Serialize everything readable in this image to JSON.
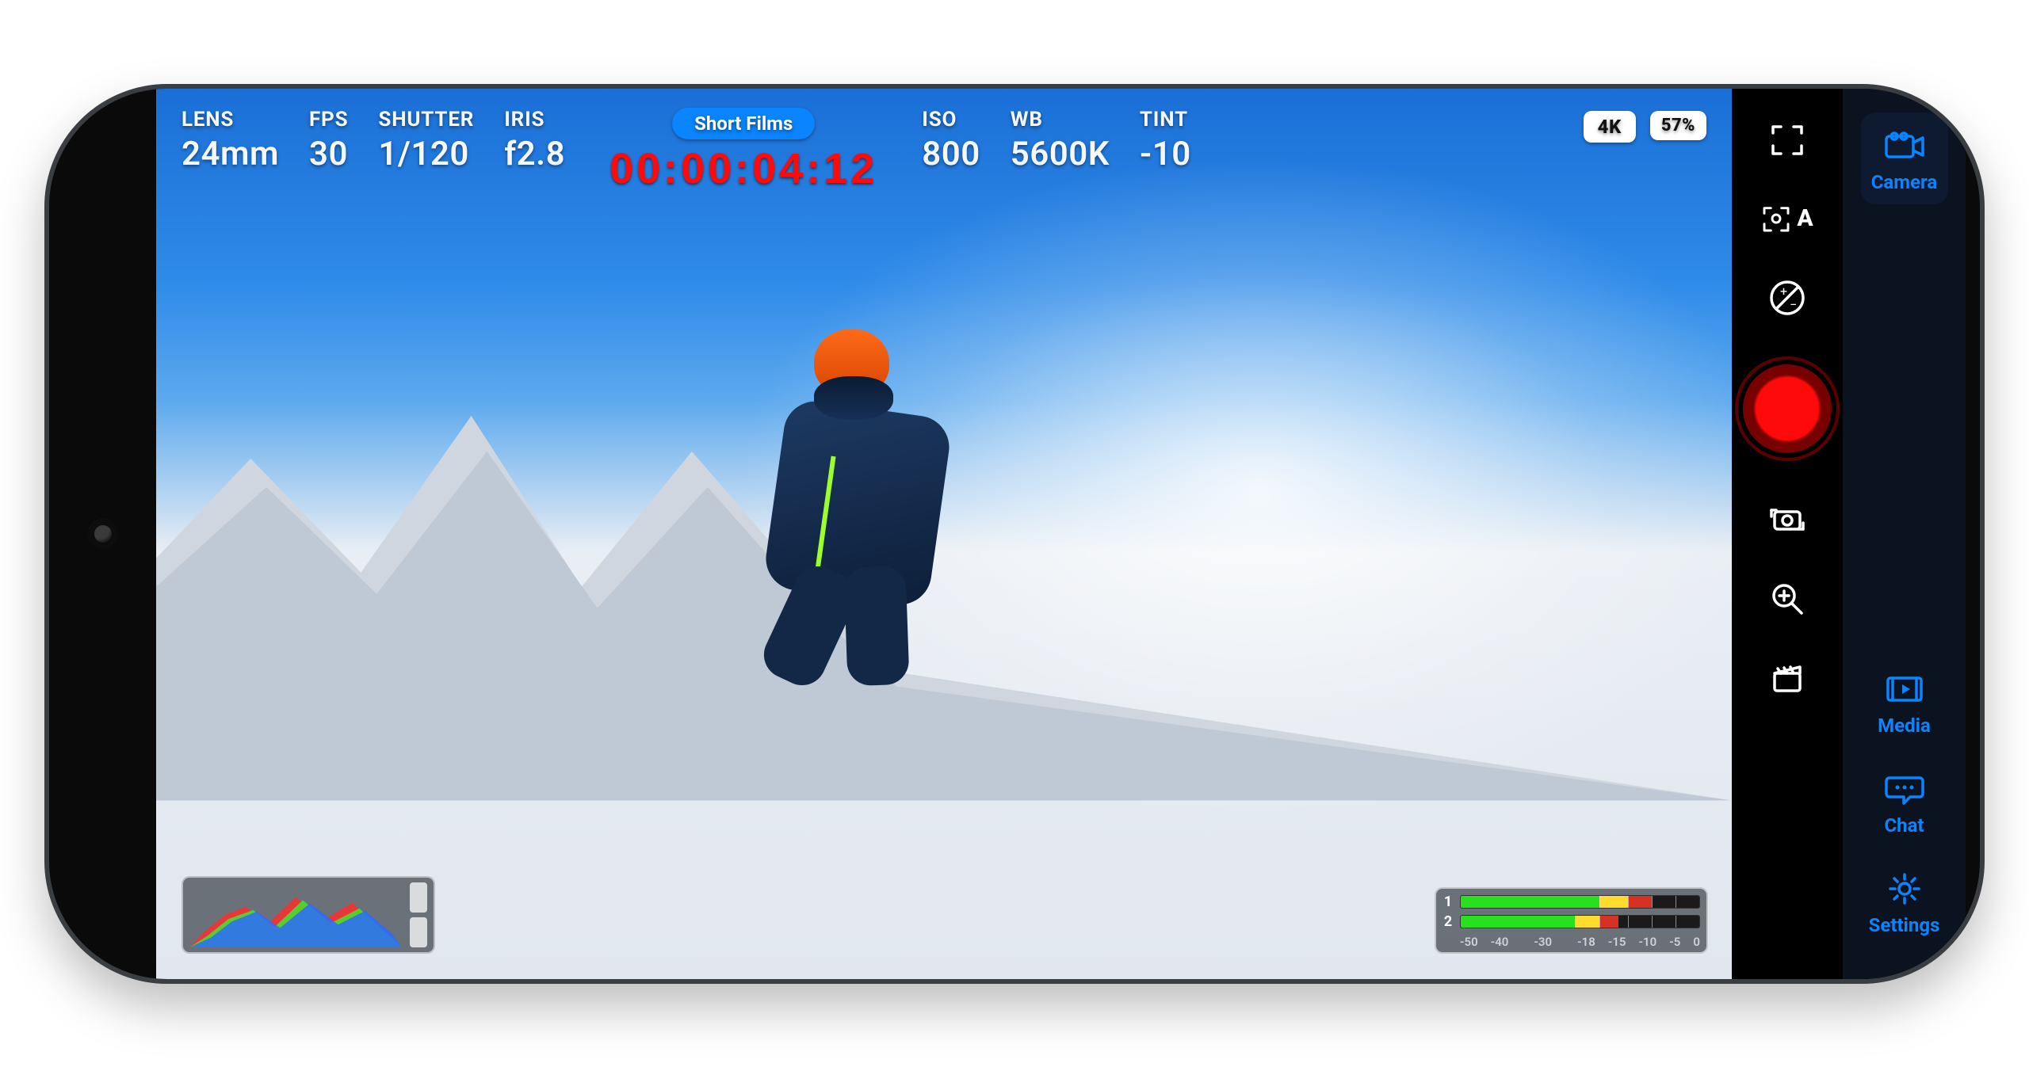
{
  "top": {
    "lens": {
      "label": "LENS",
      "value": "24mm"
    },
    "fps": {
      "label": "FPS",
      "value": "30"
    },
    "shutter": {
      "label": "SHUTTER",
      "value": "1/120"
    },
    "iris": {
      "label": "IRIS",
      "value": "f2.8"
    },
    "iso": {
      "label": "ISO",
      "value": "800"
    },
    "wb": {
      "label": "WB",
      "value": "5600K"
    },
    "tint": {
      "label": "TINT",
      "value": "-10"
    }
  },
  "project_name": "Short Films",
  "timecode": "00:00:04:12",
  "badges": {
    "resolution": "4K",
    "battery": "57%"
  },
  "audio": {
    "ch1_label": "1",
    "ch2_label": "2",
    "ch1_green_pct": 58,
    "ch1_yellow_pct": 12,
    "ch1_red_pct": 10,
    "ch2_green_pct": 48,
    "ch2_yellow_pct": 10,
    "ch2_red_pct": 8,
    "scale": [
      "-50",
      "-40",
      "",
      "-30",
      "",
      "-18",
      "-15",
      "-10",
      "-5",
      "0"
    ]
  },
  "controls": {
    "autofocus_letter": "A"
  },
  "nav": {
    "camera": "Camera",
    "media": "Media",
    "chat": "Chat",
    "settings": "Settings"
  }
}
